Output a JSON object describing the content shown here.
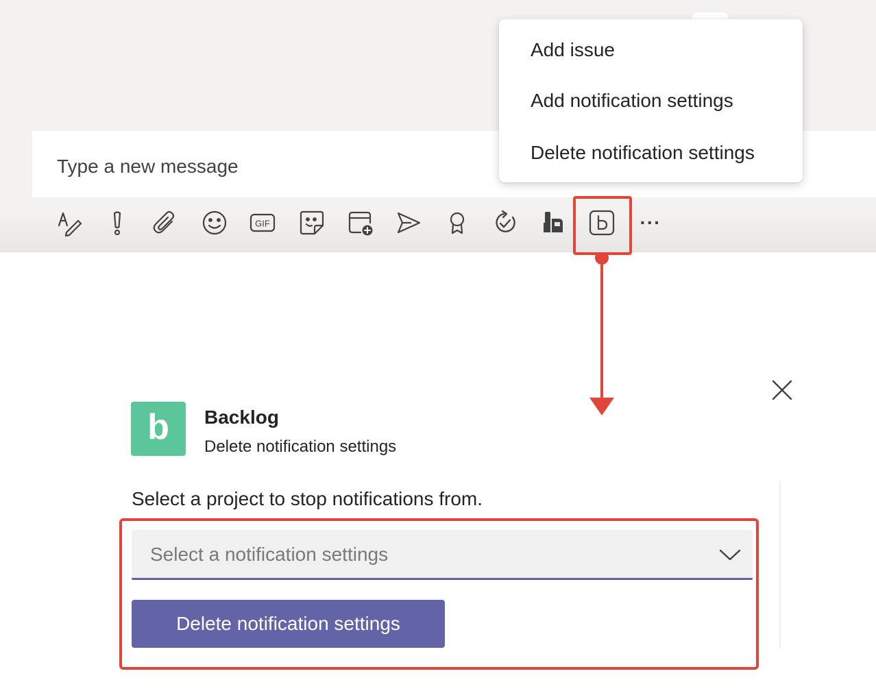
{
  "compose": {
    "placeholder": "Type a new message"
  },
  "toolbar": {
    "icons": [
      "format-icon",
      "important-icon",
      "attach-icon",
      "emoji-icon",
      "gif-icon",
      "sticker-icon",
      "schedule-meeting-icon",
      "stream-icon",
      "praise-icon",
      "loop-icon",
      "app-icon",
      "backlog-icon",
      "more-icon"
    ],
    "gif_label": "GIF",
    "more_label": "···"
  },
  "extension_menu": {
    "items": [
      "Add issue",
      "Add notification settings",
      "Delete notification settings"
    ]
  },
  "dialog": {
    "app_name": "Backlog",
    "app_subtitle": "Delete notification settings",
    "prompt": "Select a project to stop notifications from.",
    "select_placeholder": "Select a notification settings",
    "button_label": "Delete notification settings",
    "logo_letter": "b"
  },
  "colors": {
    "highlight": "#e0463a",
    "brand_purple": "#6264a7",
    "backlog_green": "#5bc69a"
  }
}
